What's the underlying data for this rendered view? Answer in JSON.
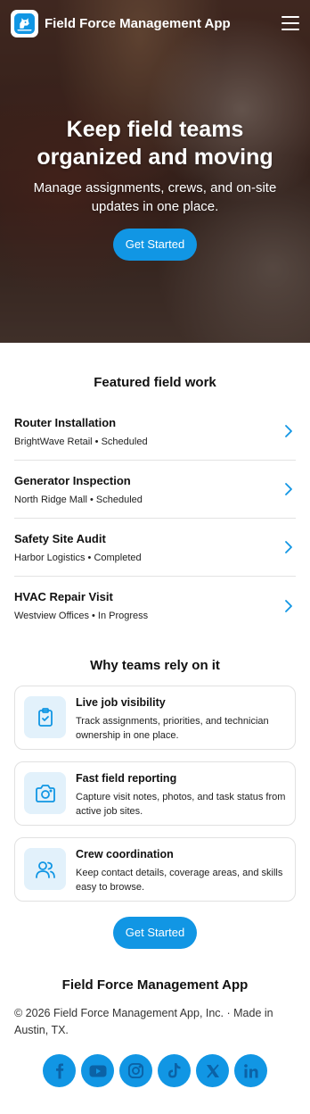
{
  "header": {
    "app_name": "Field Force Management App",
    "logo_icon": "dog-logo-icon",
    "menu_icon": "hamburger-menu-icon"
  },
  "hero": {
    "title": "Keep field teams organized and moving",
    "subtitle": "Manage assignments, crews, and on-site updates in one place.",
    "cta_label": "Get Started"
  },
  "featured": {
    "title": "Featured field work",
    "items": [
      {
        "title": "Router Installation",
        "meta": "BrightWave Retail • Scheduled"
      },
      {
        "title": "Generator Inspection",
        "meta": "North Ridge Mall • Scheduled"
      },
      {
        "title": "Safety Site Audit",
        "meta": "Harbor Logistics • Completed"
      },
      {
        "title": "HVAC Repair Visit",
        "meta": "Westview Offices • In Progress"
      }
    ]
  },
  "why": {
    "title": "Why teams rely on it",
    "cards": [
      {
        "title": "Live job visibility",
        "desc": "Track assignments, priorities, and technician ownership in one place.",
        "icon": "clipboard-check-icon"
      },
      {
        "title": "Fast field reporting",
        "desc": "Capture visit notes, photos, and task status from active job sites.",
        "icon": "camera-icon"
      },
      {
        "title": "Crew coordination",
        "desc": "Keep contact details, coverage areas, and skills easy to browse.",
        "icon": "users-icon"
      }
    ]
  },
  "cta2": {
    "label": "Get Started"
  },
  "footer": {
    "title": "Field Force Management App",
    "copyright": "© 2026 Field Force Management App, Inc. · Made in Austin, TX.",
    "socials": [
      "facebook",
      "youtube",
      "instagram",
      "tiktok",
      "x",
      "linkedin"
    ]
  },
  "colors": {
    "accent": "#1196e4",
    "icon_bg": "#e2f1fb",
    "chevron": "#1196e4"
  }
}
